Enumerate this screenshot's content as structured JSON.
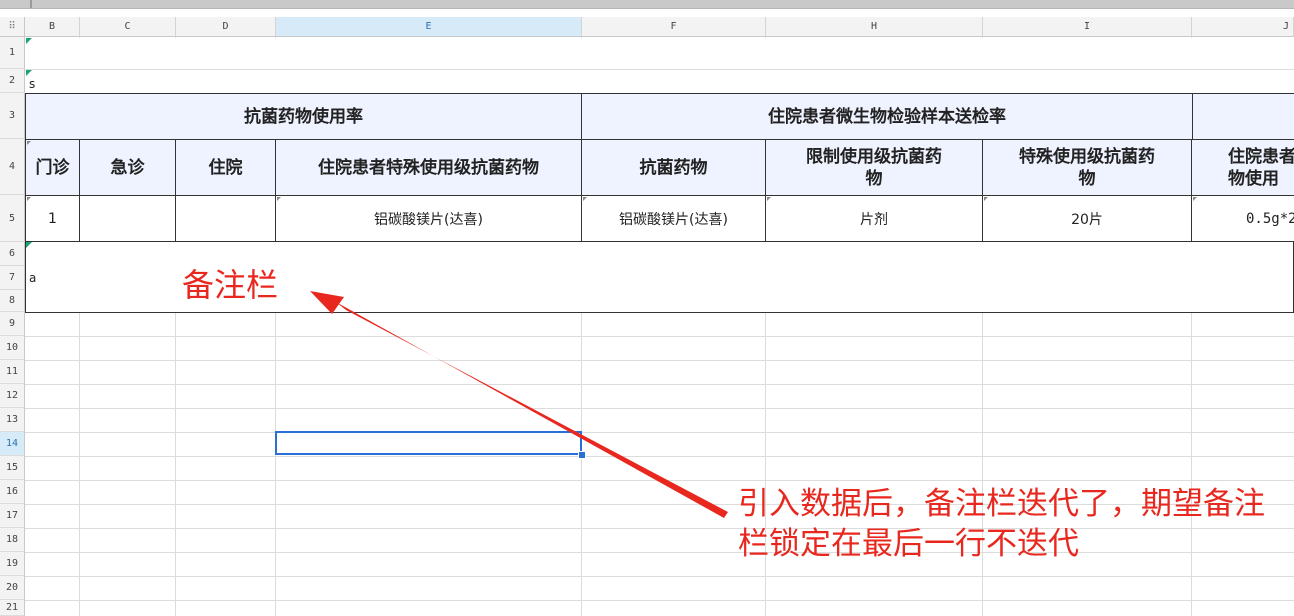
{
  "corner_label": "⠿",
  "columns": [
    {
      "id": "b",
      "label": "B",
      "selected": false
    },
    {
      "id": "c",
      "label": "C",
      "selected": false
    },
    {
      "id": "d",
      "label": "D",
      "selected": false
    },
    {
      "id": "e",
      "label": "E",
      "selected": true
    },
    {
      "id": "f",
      "label": "F",
      "selected": false
    },
    {
      "id": "h",
      "label": "H",
      "selected": false
    },
    {
      "id": "i",
      "label": "I",
      "selected": false
    },
    {
      "id": "j",
      "label": "J",
      "selected": false
    }
  ],
  "rows": [
    "1",
    "2",
    "3",
    "4",
    "5",
    "6",
    "7",
    "8",
    "9",
    "10",
    "11",
    "12",
    "13",
    "14",
    "15",
    "16",
    "17",
    "18",
    "19",
    "20",
    "21"
  ],
  "selected_row": "14",
  "row2_text": "s",
  "row7_text": "a",
  "table": {
    "group1": "抗菌药物使用率",
    "group2": "住院患者微生物检验样本送检率",
    "sub": {
      "b": "门诊",
      "c": "急诊",
      "d": "住院",
      "e": "住院患者特殊使用级抗菌药物",
      "f": "抗菌药物",
      "h": "限制使用级抗菌药物",
      "i": "特殊使用级抗菌药物",
      "j": "住院患者物使用"
    },
    "data": {
      "b": "1",
      "c": "",
      "d": "",
      "e": "铝碳酸镁片(达喜)",
      "f": "铝碳酸镁片(达喜)",
      "h": "片剂",
      "i": "20片",
      "j": "0.5g*2"
    }
  },
  "annotations": {
    "note_label": "备注栏",
    "note_message": "引入数据后，备注栏迭代了，期望备注栏锁定在最后一行不迭代",
    "color": "#e8281f"
  }
}
